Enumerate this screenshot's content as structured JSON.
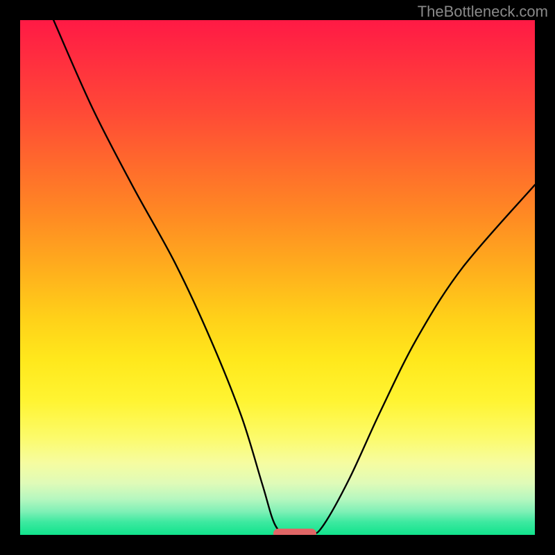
{
  "watermark": "TheBottleneck.com",
  "colors": {
    "frame": "#000000",
    "bar": "#e06666",
    "curve": "#000000"
  },
  "chart_data": {
    "type": "line",
    "title": "",
    "xlabel": "",
    "ylabel": "",
    "xlim": [
      0,
      1
    ],
    "ylim": [
      0,
      1
    ],
    "legend": false,
    "grid": false,
    "series": [
      {
        "name": "curve",
        "x": [
          0.065,
          0.14,
          0.22,
          0.3,
          0.37,
          0.43,
          0.47,
          0.495,
          0.52,
          0.565,
          0.59,
          0.64,
          0.7,
          0.77,
          0.86,
          1.0
        ],
        "y": [
          1.0,
          0.83,
          0.675,
          0.53,
          0.38,
          0.23,
          0.1,
          0.02,
          0.0,
          0.0,
          0.02,
          0.11,
          0.24,
          0.38,
          0.52,
          0.68
        ]
      }
    ],
    "annotations": [
      {
        "type": "bar",
        "x0": 0.492,
        "x1": 0.576,
        "y": 0.0,
        "color": "#e06666"
      }
    ]
  }
}
